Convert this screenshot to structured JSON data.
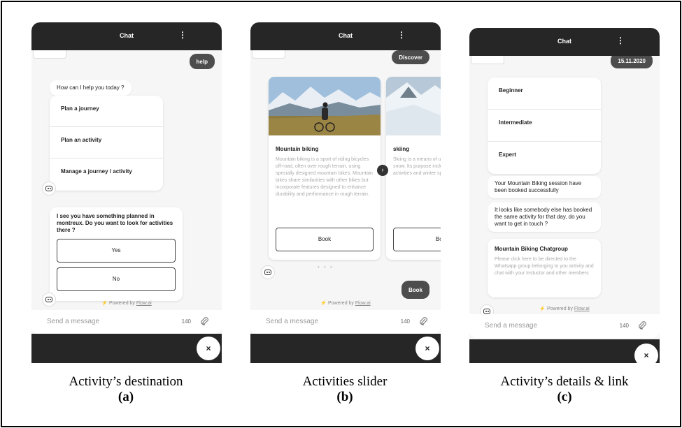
{
  "common": {
    "chat_title": "Chat",
    "menu_dots": "⋮",
    "composer_placeholder": "Send a message",
    "char_count": "140",
    "powered_prefix": "Powered by",
    "powered_link": "Flow.ai",
    "close_glyph": "×"
  },
  "panel_a": {
    "user_bubble": "help",
    "bot_greeting": "How can I help you today ?",
    "menu": [
      "Plan a journey",
      "Plan an activity",
      "Manage a journey / activity"
    ],
    "question": "I see you have something planned in montreux. Do you want to look for activities there ?",
    "options": [
      "Yes",
      "No"
    ],
    "caption": "Activity’s destination",
    "label": "(a)"
  },
  "panel_b": {
    "user_bubble": "Discover",
    "slides": [
      {
        "title": "Mountain biking",
        "description": "Mountain biking is a sport of riding bicycles off-road, often over rough terrain, using specially designed mountain bikes. Mountain bikes share similarities with other bikes but incorporate features designed to enhance durability and performance in rough terrain.",
        "button": "Book"
      },
      {
        "title": "skiing",
        "description": "Skiing is a means of using skis to glide on snow. Its purpose include basic recreational activities and winter sport.",
        "button": "Book"
      }
    ],
    "pager": "• • •",
    "user_bubble_2": "Book",
    "caption": "Activities slider",
    "label": "(b)"
  },
  "panel_c": {
    "user_bubble": "15.11.2020",
    "levels": [
      "Beginner",
      "Intermediate",
      "Expert"
    ],
    "msg_booked": "Your Mountain Biking session have been booked successfully",
    "msg_other": "It looks like somebody else has booked the same activity for that day, do you want to get in touch ?",
    "group_title": "Mountain Biking Chatgroup",
    "group_desc": "Please click here to be directed to the Whatsapp group belonging to you activity and chat with your Instuctor and other members",
    "caption": "Activity’s details & link",
    "label": "(c)"
  },
  "colors": {
    "header": "#262626",
    "user_bubble": "#4d4d4d",
    "background": "#f6f6f6",
    "bolt": "#f3b400"
  }
}
